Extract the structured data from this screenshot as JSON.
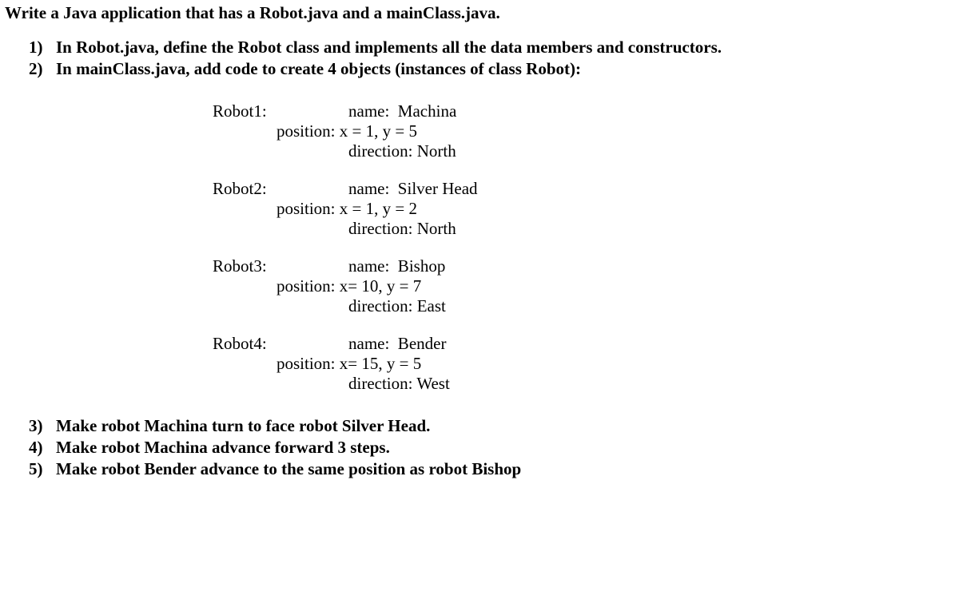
{
  "intro": "Write a Java application that has a Robot.java and a mainClass.java.",
  "items_top": [
    {
      "num": "1)",
      "text": "In Robot.java, define the Robot class and implements all the data members and constructors."
    },
    {
      "num": "2)",
      "text": "In mainClass.java, add code to create 4 objects (instances of class Robot):"
    }
  ],
  "robots": [
    {
      "label": "Robot1:",
      "name_line": "name:  Machina",
      "position_line": "position: x = 1, y = 5",
      "direction_line": "direction: North"
    },
    {
      "label": "Robot2:",
      "name_line": "name:  Silver Head",
      "position_line": "position: x = 1, y = 2",
      "direction_line": "direction: North"
    },
    {
      "label": "Robot3:",
      "name_line": "name:  Bishop",
      "position_line": "position: x= 10, y = 7",
      "direction_line": "direction: East"
    },
    {
      "label": "Robot4:",
      "name_line": "name:  Bender",
      "position_line": "position: x= 15, y = 5",
      "direction_line": "direction: West"
    }
  ],
  "items_bottom": [
    {
      "num": "3)",
      "text": "Make robot Machina turn to face robot Silver Head."
    },
    {
      "num": "4)",
      "text": "Make robot Machina advance forward 3 steps."
    },
    {
      "num": "5)",
      "text": "Make robot Bender advance to the same position as robot Bishop"
    }
  ]
}
